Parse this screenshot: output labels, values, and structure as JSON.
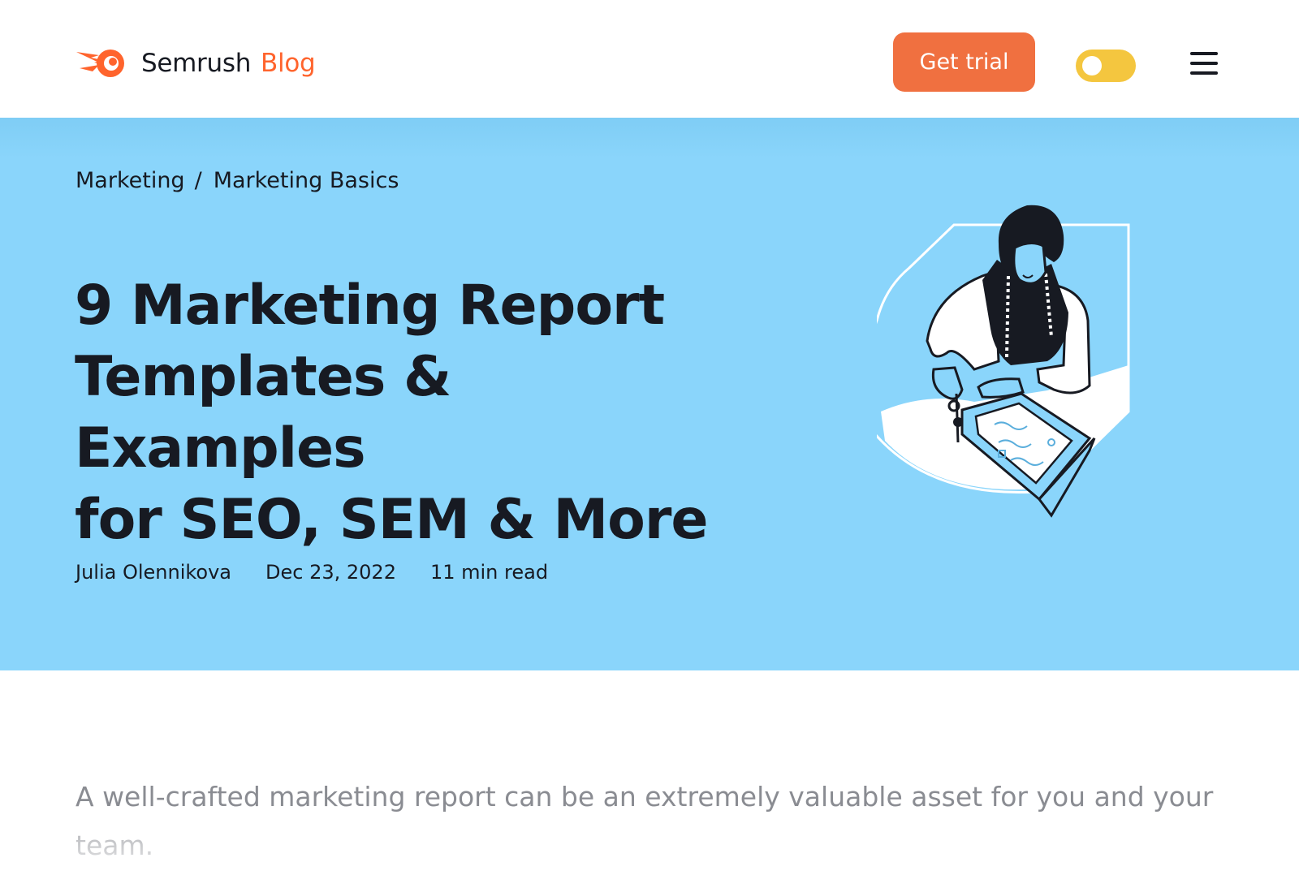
{
  "header": {
    "logo_text": "Semrush",
    "logo_suffix": "Blog",
    "cta_label": "Get trial",
    "theme_toggle_state": "light",
    "menu_icon": "hamburger-icon"
  },
  "hero": {
    "breadcrumb": [
      {
        "label": "Marketing"
      },
      {
        "label": "Marketing Basics"
      }
    ],
    "breadcrumb_separator": "/",
    "title_lines": [
      "9 Marketing Report",
      "Templates & Examples",
      "for SEO, SEM & More"
    ],
    "author": "Julia Olennikova",
    "date": "Dec 23, 2022",
    "read_time": "11 min read",
    "illustration_icon": "tailor-illustration"
  },
  "article": {
    "intro": "A well-crafted marketing report can be an extremely valuable asset for you and your team."
  },
  "colors": {
    "brand_orange": "#ff642d",
    "cta_orange": "#f07040",
    "hero_blue": "#8ad5fb",
    "toggle_yellow": "#f4c63f",
    "text_dark": "#171a22",
    "text_muted": "#8a8c92"
  }
}
